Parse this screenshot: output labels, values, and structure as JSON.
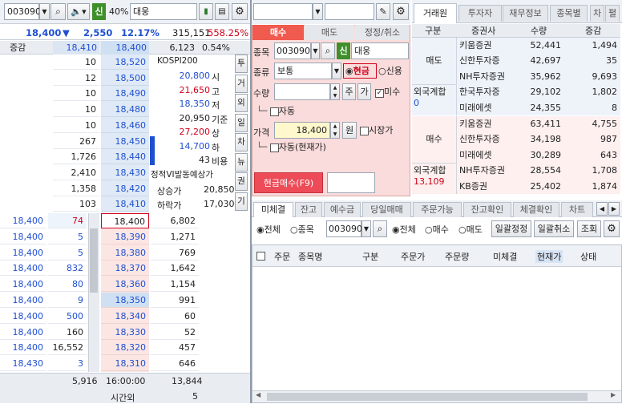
{
  "left": {
    "stock_code": "003090",
    "percent_badge": "40%",
    "stock_name": "대웅",
    "summary": {
      "price": "18,400",
      "arrow": "▼",
      "change": "2,550",
      "change_rate": "12.17%",
      "volume": "315,151",
      "vol_rate": "558.25%"
    },
    "header": {
      "label": "증감",
      "ask_total": "18,410",
      "price": "18,400",
      "volume": "6,123",
      "rate": "0.54%"
    },
    "asks": [
      {
        "qty": "10",
        "price": "18,520"
      },
      {
        "qty": "12",
        "price": "18,500"
      },
      {
        "qty": "10",
        "price": "18,490"
      },
      {
        "qty": "10",
        "price": "18,480"
      },
      {
        "qty": "10",
        "price": "18,460"
      },
      {
        "qty": "267",
        "price": "18,450"
      },
      {
        "qty": "1,726",
        "price": "18,440"
      },
      {
        "qty": "2,410",
        "price": "18,430"
      },
      {
        "qty": "1,358",
        "price": "18,420"
      },
      {
        "qty": "103",
        "price": "18,410"
      }
    ],
    "info": {
      "title": "KOSPI200",
      "rows": [
        {
          "value": "20,800",
          "label": "시",
          "color": "#1f4fd1"
        },
        {
          "value": "21,650",
          "label": "고",
          "color": "#d0021b"
        },
        {
          "value": "18,350",
          "label": "저",
          "color": "#1f4fd1"
        },
        {
          "value": "20,950",
          "label": "기준",
          "color": "#222222"
        },
        {
          "value": "27,200",
          "label": "상",
          "color": "#d0021b"
        },
        {
          "value": "14,700",
          "label": "하",
          "color": "#1f4fd1"
        },
        {
          "value": "43",
          "label": "비용",
          "color": "#222222"
        }
      ],
      "vi_label": "정적VI발동예상가",
      "up_label": "상승가",
      "up_value": "20,850",
      "down_label": "하락가",
      "down_value": "17,030"
    },
    "side_tabs": [
      "투",
      "거",
      "외",
      "일",
      "차",
      "뉴",
      "권",
      "기"
    ],
    "fills": [
      {
        "price": "18,400",
        "qty": "74"
      },
      {
        "price": "18,400",
        "qty": "5"
      },
      {
        "price": "18,400",
        "qty": "5"
      },
      {
        "price": "18,400",
        "qty": "832"
      },
      {
        "price": "18,400",
        "qty": "80"
      },
      {
        "price": "18,400",
        "qty": "9"
      },
      {
        "price": "18,400",
        "qty": "500"
      },
      {
        "price": "18,400",
        "qty": "160"
      },
      {
        "price": "18,400",
        "qty": "16,552"
      },
      {
        "price": "18,430",
        "qty": "3"
      }
    ],
    "bids": [
      {
        "price": "18,400",
        "qty": "6,802"
      },
      {
        "price": "18,390",
        "qty": "1,271"
      },
      {
        "price": "18,380",
        "qty": "769"
      },
      {
        "price": "18,370",
        "qty": "1,642"
      },
      {
        "price": "18,360",
        "qty": "1,154"
      },
      {
        "price": "18,350",
        "qty": "991"
      },
      {
        "price": "18,340",
        "qty": "60"
      },
      {
        "price": "18,330",
        "qty": "52"
      },
      {
        "price": "18,320",
        "qty": "457"
      },
      {
        "price": "18,310",
        "qty": "646"
      }
    ],
    "footer": {
      "left": "5,916",
      "time": "16:00:00",
      "right": "13,844",
      "after_label": "시간외",
      "after_value": "5"
    }
  },
  "order": {
    "tabs": [
      "매수",
      "매도",
      "정정/취소"
    ],
    "code_label": "종목",
    "code": "003090",
    "credit_badge": "신",
    "name": "대웅",
    "type_label": "종류",
    "type_value": "보통",
    "cash_label": "현금",
    "credit_label": "신용",
    "qty_label": "수량",
    "btn_ju": "주",
    "btn_ga": "가",
    "unfilled_label": "미수",
    "auto_label": "자동",
    "price_label": "가격",
    "price_value": "18,400",
    "won": "원",
    "market_label": "시장가",
    "auto_cash_label": "자동(현재가)",
    "submit": "현금매수(F9)"
  },
  "broker": {
    "tabs": [
      "거래원",
      "투자자",
      "재무정보",
      "종목별",
      "차",
      "펼"
    ],
    "headers": [
      "구분",
      "증권사",
      "수량",
      "증감"
    ],
    "sell_label": "매도",
    "sell_rows": [
      {
        "name": "키움증권",
        "qty": "52,441",
        "chg": "1,494"
      },
      {
        "name": "신한투자증",
        "qty": "42,697",
        "chg": "35"
      },
      {
        "name": "NH투자증권",
        "qty": "35,962",
        "chg": "9,693"
      },
      {
        "name": "한국투자증",
        "qty": "29,102",
        "chg": "1,802"
      },
      {
        "name": "미래에셋",
        "qty": "24,355",
        "chg": "8"
      }
    ],
    "foreign_label": "외국계합",
    "foreign_sell": "0",
    "buy_label": "매수",
    "buy_rows": [
      {
        "name": "키움증권",
        "qty": "63,411",
        "chg": "4,755"
      },
      {
        "name": "신한투자증",
        "qty": "34,198",
        "chg": "987"
      },
      {
        "name": "미래에셋",
        "qty": "30,289",
        "chg": "643"
      },
      {
        "name": "NH투자증권",
        "qty": "28,554",
        "chg": "1,708"
      },
      {
        "name": "KB증권",
        "qty": "25,402",
        "chg": "1,874"
      }
    ],
    "foreign_buy": "13,109"
  },
  "bottom": {
    "tabs": [
      "미체결",
      "잔고",
      "예수금",
      "당일매매",
      "주문가능",
      "잔고확인",
      "체결확인",
      "차트"
    ],
    "filter1": [
      "전체",
      "종목"
    ],
    "code": "003090",
    "filter2": [
      "전체",
      "매수",
      "매도"
    ],
    "buttons": [
      "일괄정정",
      "일괄취소",
      "조회"
    ],
    "headers": [
      "주문",
      "종목명",
      "구분",
      "주문가",
      "주문량",
      "미체결",
      "현재가",
      "상태"
    ]
  }
}
